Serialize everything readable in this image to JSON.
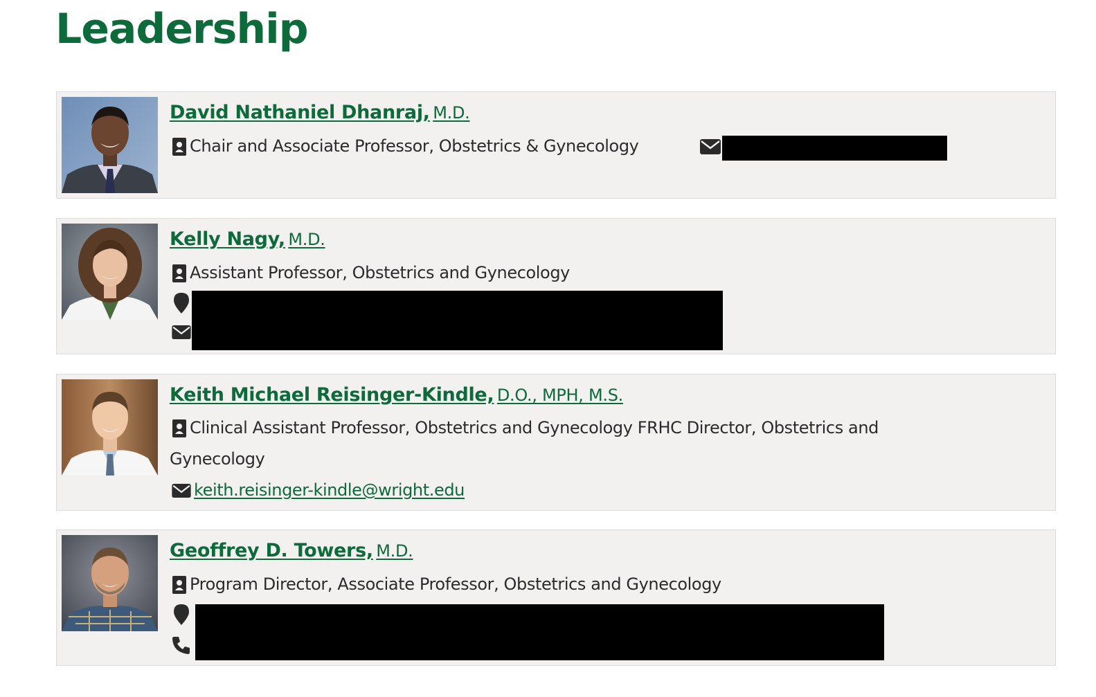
{
  "page": {
    "title": "Leadership"
  },
  "colors": {
    "brand_green": "#0d6a3a",
    "card_bg": "#f2f1f0",
    "text": "#2b2b2b",
    "redaction": "#000000"
  },
  "people": [
    {
      "name": "David Nathaniel Dhanraj,",
      "credentials": "M.D.",
      "title": "Chair and Associate Professor, Obstetrics & Gynecology",
      "title_icon": "id-badge-icon",
      "email_icon": "envelope-icon",
      "email_redacted": true
    },
    {
      "name": "Kelly Nagy,",
      "credentials": "M.D.",
      "title": "Assistant Professor, Obstetrics and Gynecology",
      "title_icon": "id-badge-icon",
      "location_icon": "map-pin-icon",
      "email_icon": "envelope-icon",
      "location_redacted": true,
      "email_redacted": true
    },
    {
      "name": "Keith Michael Reisinger-Kindle,",
      "credentials": "D.O., MPH, M.S.",
      "title": "Clinical Assistant Professor, Obstetrics and Gynecology FRHC Director, Obstetrics and Gynecology",
      "title_icon": "id-badge-icon",
      "email_icon": "envelope-icon",
      "email": "keith.reisinger-kindle@wright.edu"
    },
    {
      "name": "Geoffrey D. Towers,",
      "credentials": "M.D.",
      "title": "Program Director, Associate Professor, Obstetrics and Gynecology",
      "title_icon": "id-badge-icon",
      "location_icon": "map-pin-icon",
      "phone_icon": "phone-icon",
      "location_redacted": true,
      "phone_redacted": true
    }
  ]
}
